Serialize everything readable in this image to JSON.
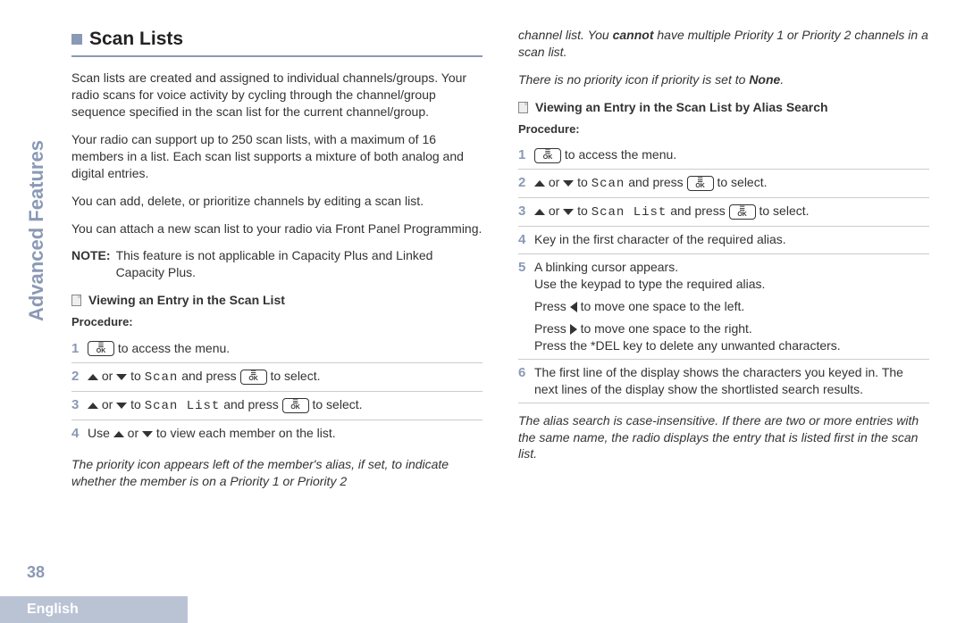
{
  "sidebar_label": "Advanced Features",
  "page_number": "38",
  "footer_language": "English",
  "left": {
    "title": "Scan Lists",
    "p1": "Scan lists are created and assigned to individual channels/groups. Your radio scans for voice activity by cycling through the channel/group sequence specified in the scan list for the current channel/group.",
    "p2": "Your radio can support up to 250 scan lists, with a maximum of 16 members in a list. Each scan list supports a mixture of both analog and digital entries.",
    "p3": "You can add, delete, or prioritize channels by editing a scan list.",
    "p4": "You can attach a new scan list to your radio via Front Panel Programming.",
    "note_label": "NOTE:",
    "note_text": "This feature is not applicable in Capacity Plus and Linked Capacity Plus.",
    "sub1": "Viewing an Entry in the Scan List",
    "proc_label": "Procedure:",
    "steps": {
      "s1_tail": " to access the menu.",
      "s2_mid": " to ",
      "s2_scan": "Scan",
      "s2_press": " and press ",
      "s2_tail": " to select.",
      "s3_mid": " to ",
      "s3_scanlist": "Scan List",
      "s3_press": " and press ",
      "s3_tail": " to select.",
      "s4_a": "Use ",
      "s4_b": " or ",
      "s4_c": " to view each member on the list."
    },
    "footer_italic": "The priority icon appears left of the member's alias, if set, to indicate whether the member is on a Priority 1 or Priority 2"
  },
  "right": {
    "cont_a": "channel list. You ",
    "cont_b": "cannot",
    "cont_c": " have multiple Priority 1 or Priority 2 channels in a scan list.",
    "p2_a": "There is no priority icon if priority is set to ",
    "p2_b": "None",
    "p2_c": ".",
    "sub1": "Viewing an Entry in the Scan List by Alias Search",
    "proc_label": "Procedure:",
    "steps": {
      "s1_tail": " to access the menu.",
      "s2_mid": " to ",
      "s2_scan": "Scan",
      "s2_press": " and press ",
      "s2_tail": " to select.",
      "s3_mid": " to ",
      "s3_scanlist": "Scan List",
      "s3_press": " and press ",
      "s3_tail": " to select.",
      "s4": "Key in the first character of the required alias.",
      "s5_a": "A blinking cursor appears.",
      "s5_b": "Use the keypad to type the required alias.",
      "s5_c_pre": "Press ",
      "s5_c_post": " to move one space to the left.",
      "s5_d_pre": "Press ",
      "s5_d_post": " to move one space to the right.",
      "s5_e": "Press the *DEL key to delete any unwanted characters.",
      "s6": "The first line of the display shows the characters you keyed in. The next lines of the display show the shortlisted search results."
    },
    "footer_italic": "The alias search is case-insensitive. If there are two or more entries with the same name, the radio displays the entry that is listed first in the scan list."
  },
  "ok_label_top": "☰",
  "ok_label_bottom": "OK",
  "or_text": " or "
}
